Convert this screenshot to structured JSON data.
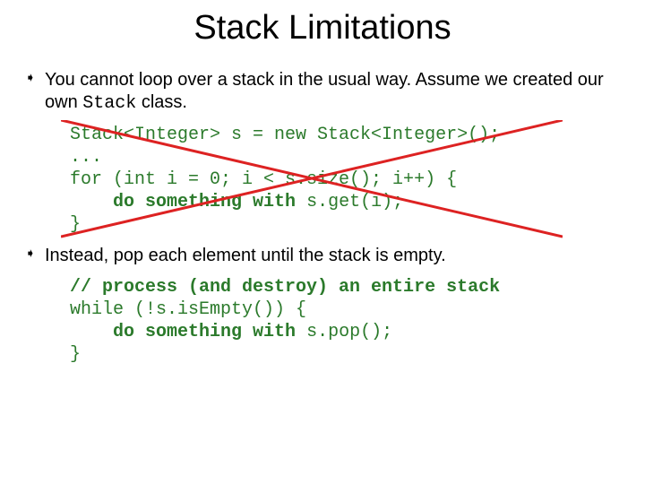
{
  "title": "Stack Limitations",
  "bullet1_pre": "You cannot loop over a stack in the usual way. Assume we created our own ",
  "bullet1_mono": "Stack",
  "bullet1_post": " class.",
  "code1_l1": "Stack<Integer> s = new Stack<Integer>();",
  "code1_l2": "...",
  "code1_l3": "for (int i = 0; i < s.size(); i++) {",
  "code1_l4a": "    ",
  "code1_l4b": "do something with",
  "code1_l4c": " s.get(i);",
  "code1_l5": "}",
  "bullet2": "Instead, pop each element until the stack is empty.",
  "code2_l1": "// process (and destroy) an entire stack",
  "code2_l2": "while (!s.isEmpty()) {",
  "code2_l3a": "    ",
  "code2_l3b": "do something with",
  "code2_l3c": " s.pop();",
  "code2_l4": "}",
  "cross_color": "#d22",
  "marker": "➧"
}
